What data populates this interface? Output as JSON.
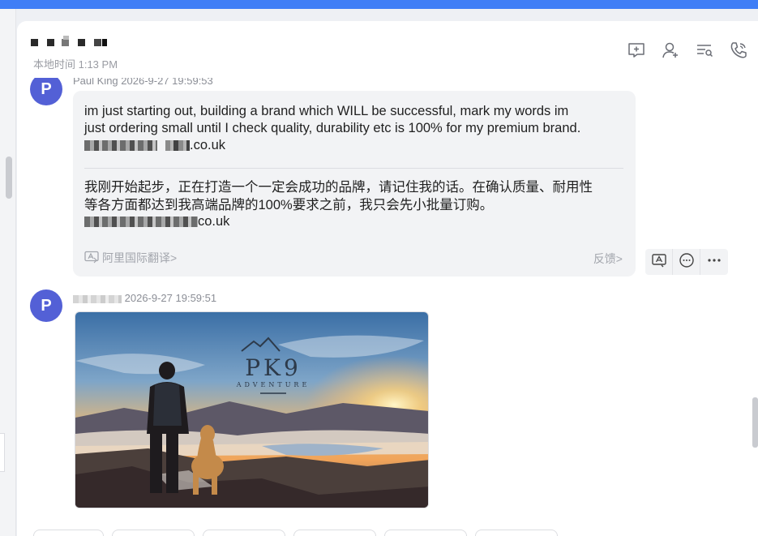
{
  "header": {
    "local_time": "本地时间 1:13 PM"
  },
  "header_icons": [
    "chat-add-icon",
    "add-contact-icon",
    "search-list-icon",
    "call-icon"
  ],
  "messages": [
    {
      "avatar_letter": "P",
      "sender": "Paul King",
      "timestamp": "2026-9-27 19:59:53",
      "original_line1": "im just starting out, building a brand which WILL be successful, mark my words im",
      "original_line2": "just ordering small until I check quality, durability etc is 100% for my premium brand.",
      "original_domain": ".co.uk",
      "translation_line1": "我刚开始起步，正在打造一个一定会成功的品牌，请记住我的话。在确认质量、耐用性",
      "translation_line2": "等各方面都达到我高端品牌的100%要求之前，我只会先小批量订购。",
      "translation_domain": "co.uk",
      "translate_link": "阿里国际翻译>",
      "feedback": "反馈>"
    },
    {
      "avatar_letter": "P",
      "timestamp": "2026-9-27 19:59:51",
      "image": {
        "brand": "PK9",
        "tagline": "ADVENTURE"
      }
    }
  ]
}
